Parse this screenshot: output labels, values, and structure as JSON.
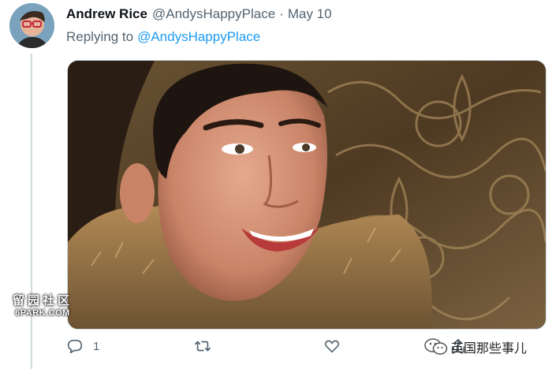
{
  "tweet": {
    "author": {
      "display_name": "Andrew Rice",
      "handle": "@AndysHappyPlace",
      "separator": "·",
      "date": "May 10"
    },
    "reply": {
      "prefix": "Replying to",
      "handle": "@AndysHappyPlace"
    },
    "media": {
      "kind": "photo"
    },
    "actions": {
      "reply_icon": "reply-bubble-icon",
      "reply_count": "1",
      "retweet_icon": "retweet-icon",
      "like_icon": "heart-icon",
      "share_icon": "share-icon"
    }
  },
  "watermarks": {
    "left_title": "留园社区",
    "left_sub": "6PARK.COM",
    "right_text": "英国那些事儿",
    "right_icon": "wechat-icon"
  },
  "colors": {
    "link": "#1d9bf0",
    "muted_text": "#536471",
    "primary_text": "#0f1419",
    "thread_line": "#cfd9de"
  }
}
